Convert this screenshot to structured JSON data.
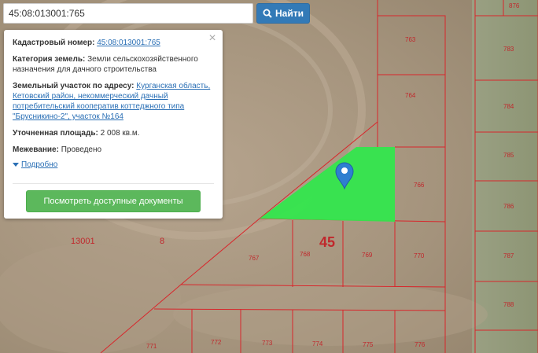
{
  "search": {
    "value": "45:08:013001:765",
    "button_label": "Найти"
  },
  "popup": {
    "cadastral_label": "Кадастровый номер:",
    "cadastral_value": "45:08:013001:765",
    "category_label": "Категория земель:",
    "category_value": "Земли сельскохозяйственного назначения для дачного строительства",
    "address_label": "Земельный участок по адресу:",
    "address_value": "Курганская область, Кетовский район, некоммерческий дачный потребительский кооператив коттеджного типа \"Брусникино-2\", участок №164",
    "area_label": "Уточненная площадь:",
    "area_value": "2 008 кв.м.",
    "survey_label": "Межевание:",
    "survey_value": "Проведено",
    "more_label": "Подробно",
    "docs_button_label": "Посмотреть доступные документы"
  },
  "map": {
    "block_label": "45",
    "quarter_label": "13001",
    "side_label": "8",
    "plots": [
      "763",
      "764",
      "766",
      "767",
      "768",
      "769",
      "770",
      "771",
      "772",
      "773",
      "774",
      "775",
      "776",
      "783",
      "784",
      "785",
      "786",
      "787",
      "788",
      "876"
    ],
    "highlight_color": "#33e64d",
    "boundary_color": "#d8262b"
  }
}
